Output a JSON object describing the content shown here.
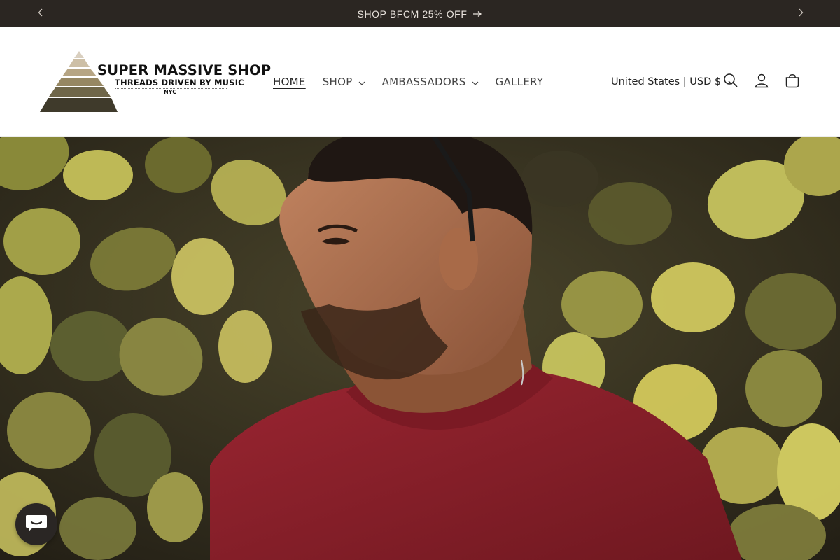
{
  "announcement": {
    "text": "SHOP BFCM 25% OFF",
    "prev_icon": "chevron-left-icon",
    "next_icon": "chevron-right-icon",
    "link_icon": "arrow-right-icon"
  },
  "header": {
    "logo": {
      "brand": "SUPER MASSIVE SHOP",
      "tagline": "THREADS DRIVEN BY MUSIC",
      "city": "NYC"
    },
    "nav": [
      {
        "label": "HOME",
        "active": true
      },
      {
        "label": "SHOP",
        "has_dropdown": true
      },
      {
        "label": "AMBASSADORS",
        "has_dropdown": true
      },
      {
        "label": "GALLERY"
      }
    ],
    "localization": "United States | USD $",
    "icons": [
      "search-icon",
      "account-icon",
      "cart-icon"
    ]
  },
  "hero": {
    "image": "man-in-red-sweatshirt-with-leaves-background"
  },
  "chat": {
    "icon": "chat-icon"
  },
  "colors": {
    "announcement_bg": "#2b2622",
    "sweatshirt": "#8e1f2a",
    "chat_bg": "#2a2624"
  }
}
